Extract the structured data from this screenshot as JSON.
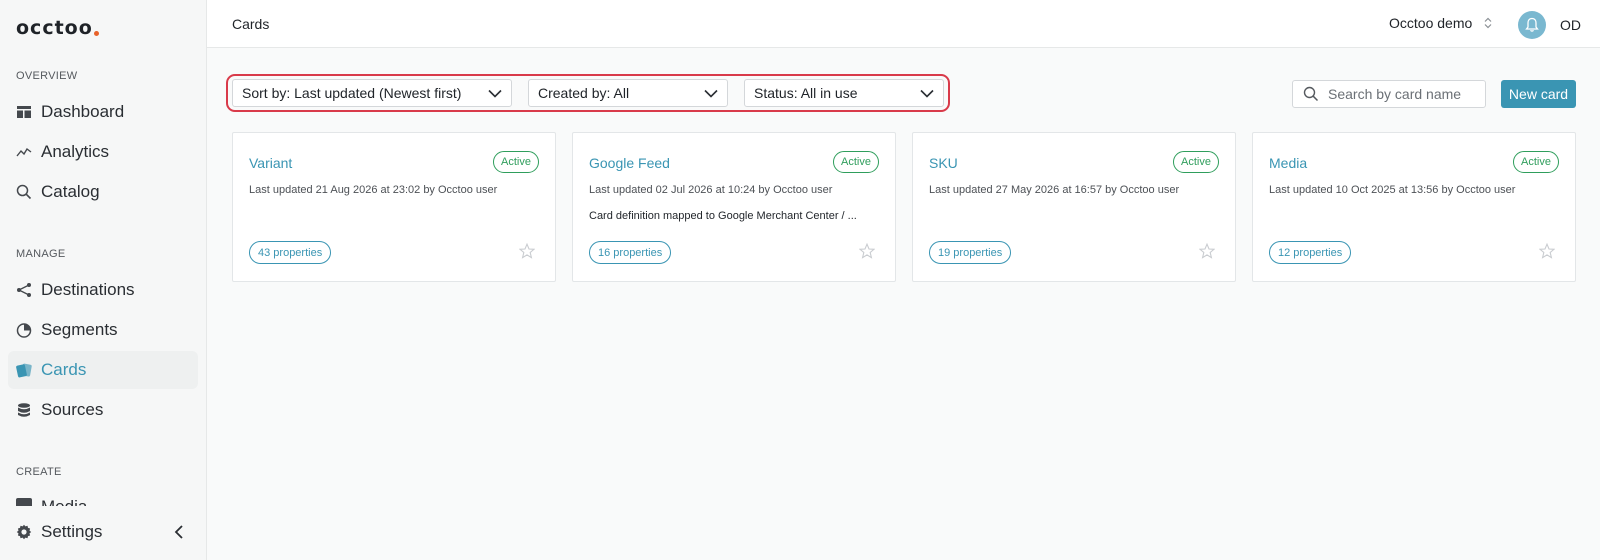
{
  "app": {
    "logo_text": "occtoo",
    "logo_dot_color": "#e8622a"
  },
  "sidebar": {
    "sections": {
      "overview": "OVERVIEW",
      "manage": "MANAGE",
      "create": "CREATE"
    },
    "items": [
      {
        "label": "Dashboard",
        "icon": "dashboard-icon"
      },
      {
        "label": "Analytics",
        "icon": "analytics-icon"
      },
      {
        "label": "Catalog",
        "icon": "search-icon"
      },
      {
        "label": "Destinations",
        "icon": "share-icon"
      },
      {
        "label": "Segments",
        "icon": "pie-chart-icon"
      },
      {
        "label": "Cards",
        "icon": "cards-icon",
        "active": true
      },
      {
        "label": "Sources",
        "icon": "database-icon"
      }
    ],
    "clipped_item": {
      "label": "Media",
      "icon": "media-icon"
    },
    "settings": {
      "label": "Settings",
      "icon": "gear-icon"
    }
  },
  "topbar": {
    "page_title": "Cards",
    "workspace": "Occtoo demo",
    "user_initials": "OD"
  },
  "filters": {
    "sort": "Sort by: Last updated (Newest first)",
    "created_by": "Created by: All",
    "status": "Status: All in use"
  },
  "search": {
    "placeholder": "Search by card name"
  },
  "actions": {
    "new_card": "New card"
  },
  "colors": {
    "accent": "#3a95b3",
    "active_badge": "#2f9e5c",
    "highlight": "#d93a4a"
  },
  "cards": [
    {
      "title": "Variant",
      "status": "Active",
      "updated": "Last updated 21 Aug 2026 at 23:02 by Occtoo user",
      "description": "",
      "properties": "43 properties"
    },
    {
      "title": "Google Feed",
      "status": "Active",
      "updated": "Last updated 02 Jul 2026 at 10:24 by Occtoo user",
      "description": "Card definition mapped to Google Merchant Center / ...",
      "properties": "16 properties"
    },
    {
      "title": "SKU",
      "status": "Active",
      "updated": "Last updated 27 May 2026 at 16:57 by Occtoo user",
      "description": "",
      "properties": "19 properties"
    },
    {
      "title": "Media",
      "status": "Active",
      "updated": "Last updated 10 Oct 2025 at 13:56 by Occtoo user",
      "description": "",
      "properties": "12 properties"
    }
  ]
}
